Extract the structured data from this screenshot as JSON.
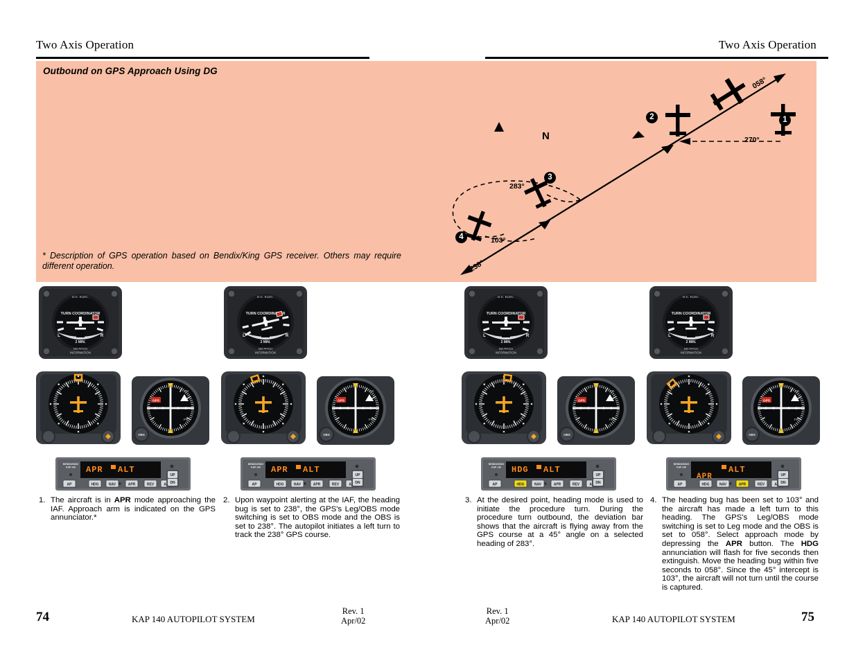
{
  "document": {
    "running_head": "Two Axis Operation",
    "footer_title": "KAP 140 AUTOPILOT SYSTEM",
    "revision": "Rev. 1",
    "revision_date": "Apr/02",
    "page_left": "74",
    "page_right": "75"
  },
  "figure": {
    "title": "Outbound on GPS Approach Using DG",
    "note": "* Description of GPS operation based on Bendix/King GPS receiver. Others may require different operation.",
    "background_color": "#f9c0a7",
    "north_label": "N",
    "north_icon": "north-arrow-icon",
    "labels": {
      "inbound_course": "270°",
      "outbound_course": "238°",
      "final_course": "058°",
      "procedure_turn_outbound": "283°",
      "procedure_turn_inbound": "103°"
    },
    "callouts": [
      "1",
      "2",
      "3",
      "4"
    ]
  },
  "instruments": {
    "turn_coordinator": {
      "power_label": "D.C. ELEC.",
      "title": "TURN COORDINATOR",
      "left_mark": "L",
      "right_mark": "R",
      "rate_label": "2 MIN.",
      "pitch_note_line1": "NO PITCH",
      "pitch_note_line2": "INFORMATION"
    },
    "cdi": {
      "flag": "GPS",
      "to_label": "TO",
      "from_label": "FR",
      "knob_label": "OBS"
    },
    "autopilot": {
      "brand_line1": "BENDIX/KING",
      "brand_line2": "KAP 140",
      "buttons": [
        "AP",
        "HDG",
        "NAV",
        "APR",
        "REV",
        "ALT"
      ],
      "rocker_up": "UP",
      "rocker_dn": "DN",
      "display_color": "#ff8c1a"
    }
  },
  "panels": [
    {
      "id": 1,
      "ap_display_top": "APR",
      "ap_display_top2": "ALT",
      "ap_display_bottom": "",
      "active_button": "",
      "bank": "level",
      "heading_bug_deg": 0
    },
    {
      "id": 2,
      "ap_display_top": "APR",
      "ap_display_top2": "ALT",
      "ap_display_bottom": "",
      "active_button": "",
      "bank": "left",
      "heading_bug_deg": -18
    },
    {
      "id": 3,
      "ap_display_top": "HDG",
      "ap_display_top2": "ALT",
      "ap_display_bottom": "",
      "active_button": "HDG",
      "bank": "level",
      "heading_bug_deg": 8
    },
    {
      "id": 4,
      "ap_display_top": "",
      "ap_display_top2": "ALT",
      "ap_display_bottom": "APR",
      "active_button": "APR",
      "bank": "level",
      "heading_bug_deg": -40
    }
  ],
  "captions": [
    {
      "number": "1.",
      "parts": [
        {
          "t": "The aircraft is in "
        },
        {
          "t": "APR",
          "b": true
        },
        {
          "t": " mode approaching the IAF. Approach arm is indicated on the GPS annunciator.*"
        }
      ]
    },
    {
      "number": "2.",
      "parts": [
        {
          "t": "Upon waypoint alerting at the IAF, the heading bug is set to 238°, the GPS's Leg/OBS mode switching is set to OBS mode and the OBS is set to 238°. The autopilot initiates a left turn to track the 238° GPS course."
        }
      ]
    },
    {
      "number": "3.",
      "parts": [
        {
          "t": "At the desired point, heading mode is used to initiate the procedure turn. During the procedure turn outbound, the deviation bar shows that the aircraft is flying away from the GPS course at a 45° angle on a selected heading of 283°."
        }
      ]
    },
    {
      "number": "4.",
      "parts": [
        {
          "t": "The heading bug has been set to 103° and the aircraft has made a left turn to this heading. The GPS's Leg/OBS mode switching is set to Leg mode and the OBS is set to 058°. Select approach mode by depressing the "
        },
        {
          "t": "APR",
          "b": true
        },
        {
          "t": " button. The "
        },
        {
          "t": "HDG",
          "b": true
        },
        {
          "t": " annunciation will flash for five seconds then extinguish. Move the heading bug within five seconds to 058°. Since the 45° intercept is 103°, the aircraft will not turn until the course is captured."
        }
      ]
    }
  ]
}
